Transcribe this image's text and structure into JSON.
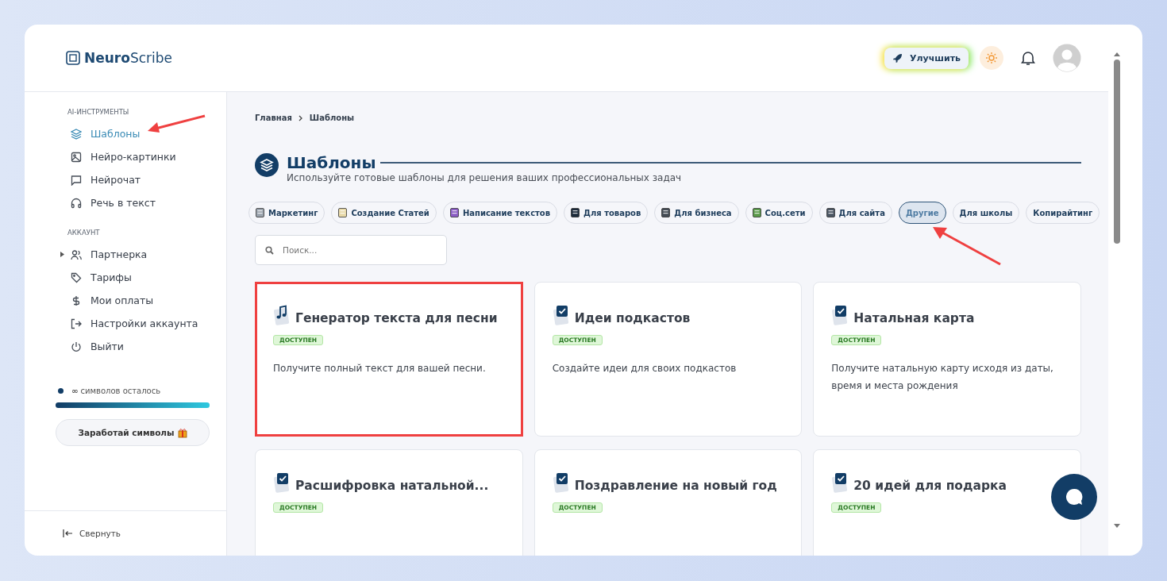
{
  "logo": {
    "bold": "Neuro",
    "light": "Scribe"
  },
  "header": {
    "upgrade_label": "Улучшить"
  },
  "sidebar": {
    "sections": [
      {
        "title": "AI-ИНСТРУМЕНТЫ",
        "items": [
          {
            "label": "Шаблоны",
            "selected": true
          },
          {
            "label": "Нейро-картинки",
            "selected": false
          },
          {
            "label": "Нейрочат",
            "selected": false
          },
          {
            "label": "Речь в текст",
            "selected": false
          }
        ]
      },
      {
        "title": "АККАУНТ",
        "items": [
          {
            "label": "Партнерка",
            "selected": false,
            "expanded": false
          },
          {
            "label": "Тарифы",
            "selected": false
          },
          {
            "label": "Мои оплаты",
            "selected": false
          },
          {
            "label": "Настройки аккаунта",
            "selected": false
          },
          {
            "label": "Выйти",
            "selected": false
          }
        ]
      }
    ],
    "credits": {
      "text": "**∞** символов осталось",
      "level": 1
    },
    "earn_button": "Заработай символы",
    "collapse_label": "Свернуть"
  },
  "breadcrumb": [
    "Главная",
    "Шаблоны"
  ],
  "page": {
    "title": "Шаблоны",
    "subtitle": "Используйте готовые шаблоны для решения ваших профессиональных задач"
  },
  "tabs": [
    {
      "label": "Маркетинг",
      "kind": "emoji",
      "selected": false
    },
    {
      "label": "Создание Статей",
      "kind": "emoji",
      "selected": false
    },
    {
      "label": "Написание текстов",
      "kind": "emoji",
      "selected": false
    },
    {
      "label": "Для товаров",
      "kind": "emoji",
      "selected": false
    },
    {
      "label": "Для бизнеса",
      "kind": "emoji",
      "selected": false
    },
    {
      "label": "Соц.сети",
      "kind": "emoji",
      "selected": false
    },
    {
      "label": "Для сайта",
      "kind": "emoji",
      "selected": false
    },
    {
      "label": "Другие",
      "kind": "plain",
      "selected": true
    },
    {
      "label": "Для школы",
      "kind": "plain",
      "selected": false
    },
    {
      "label": "Копирайтинг",
      "kind": "plain",
      "selected": false
    }
  ],
  "search": {
    "placeholder": "Поиск..."
  },
  "cards": [
    {
      "title": "Генератор текста для песни",
      "kind": "music",
      "badge": "ДОСТУПЕН",
      "description": "Получите полный текст для вашей песни.",
      "highlighted": true
    },
    {
      "title": "Идеи подкастов",
      "kind": "check",
      "badge": "ДОСТУПЕН",
      "description": "Создайте идеи для своих подкастов",
      "highlighted": false
    },
    {
      "title": "Натальная карта",
      "kind": "check",
      "badge": "ДОСТУПЕН",
      "description": "Получите натальную карту исходя из даты, время и места рождения",
      "highlighted": false
    },
    {
      "title": "Расшифровка натальной...",
      "kind": "check",
      "badge": "ДОСТУПЕН",
      "highlighted": false
    },
    {
      "title": "Поздравление на новый год",
      "kind": "check",
      "badge": "ДОСТУПЕН",
      "highlighted": false
    },
    {
      "title": "20 идей для подарка",
      "kind": "check",
      "badge": "ДОСТУПЕН",
      "highlighted": false
    }
  ]
}
